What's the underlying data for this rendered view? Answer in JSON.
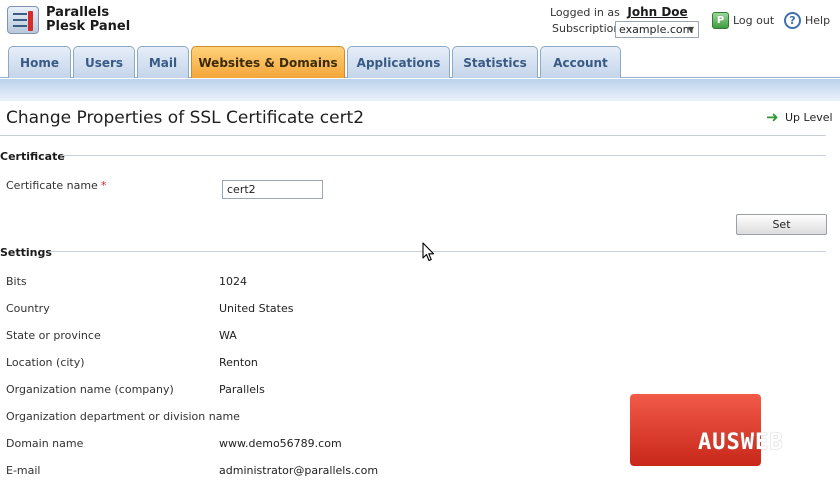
{
  "header": {
    "brand_line1": "Parallels",
    "brand_line2": "Plesk Panel",
    "logged_in_label": "Logged in as",
    "user_name": "John Doe",
    "subscription_label": "Subscription",
    "subscription_value": "example.com",
    "logout_label": "Log out",
    "help_label": "Help"
  },
  "tabs": [
    {
      "label": "Home",
      "active": false
    },
    {
      "label": "Users",
      "active": false
    },
    {
      "label": "Mail",
      "active": false
    },
    {
      "label": "Websites & Domains",
      "active": true
    },
    {
      "label": "Applications",
      "active": false
    },
    {
      "label": "Statistics",
      "active": false
    },
    {
      "label": "Account",
      "active": false
    }
  ],
  "page": {
    "title": "Change Properties of SSL Certificate cert2",
    "up_level": "Up Level"
  },
  "certificate": {
    "section_title": "Certificate",
    "name_label": "Certificate name",
    "required_mark": "*",
    "name_value": "cert2",
    "set_button": "Set"
  },
  "settings": {
    "section_title": "Settings",
    "rows": [
      {
        "label": "Bits",
        "value": "1024"
      },
      {
        "label": "Country",
        "value": "United States"
      },
      {
        "label": "State or province",
        "value": "WA"
      },
      {
        "label": "Location (city)",
        "value": "Renton"
      },
      {
        "label": "Organization name (company)",
        "value": "Parallels"
      },
      {
        "label": "Organization department or division name",
        "value": ""
      },
      {
        "label": "Domain name",
        "value": "www.demo56789.com"
      },
      {
        "label": "E-mail",
        "value": "administrator@parallels.com"
      }
    ]
  },
  "watermark": {
    "text": "AUSWEB"
  },
  "colors": {
    "active_tab": "#f4a63a",
    "tab": "#c4d5ea",
    "band": "#bcd2ec",
    "required": "#d51f1f",
    "watermark": "#e0392a"
  }
}
